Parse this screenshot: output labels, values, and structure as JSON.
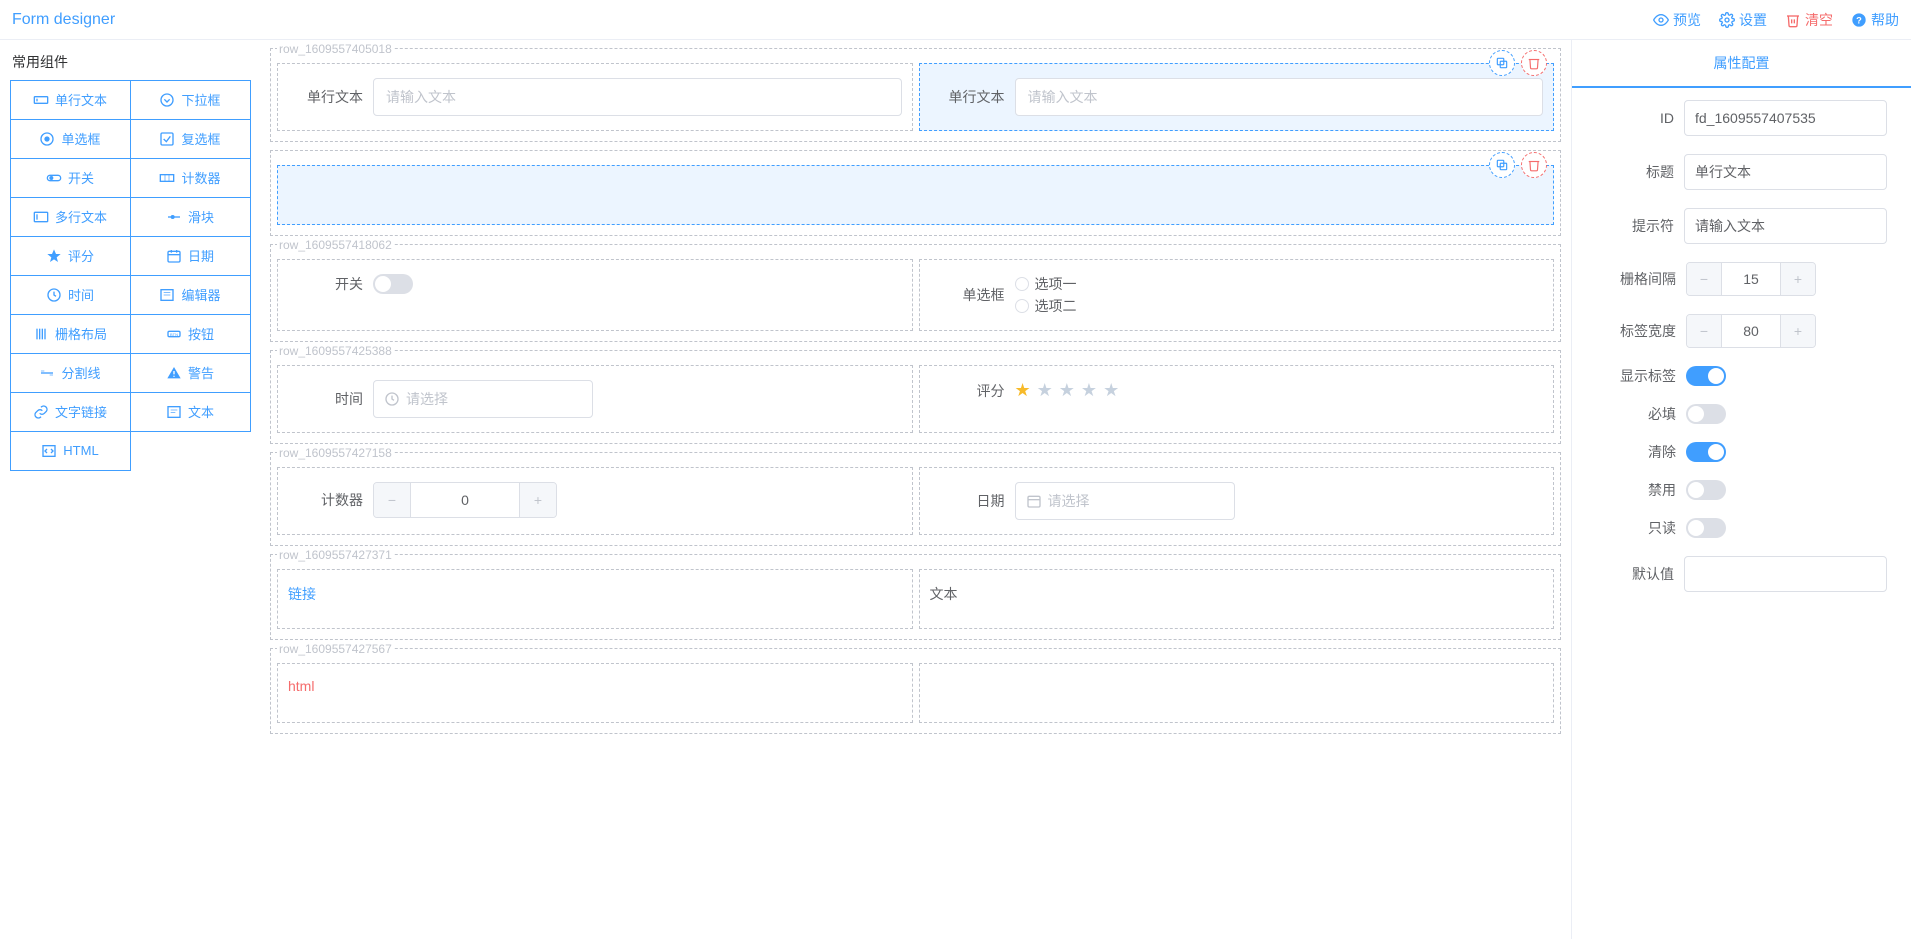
{
  "header": {
    "title": "Form designer",
    "buttons": {
      "preview": "预览",
      "settings": "设置",
      "clear": "清空",
      "help": "帮助"
    }
  },
  "sidebar": {
    "title": "常用组件",
    "items": [
      {
        "icon": "input",
        "label": "单行文本"
      },
      {
        "icon": "select",
        "label": "下拉框"
      },
      {
        "icon": "radio",
        "label": "单选框"
      },
      {
        "icon": "checkbox",
        "label": "复选框"
      },
      {
        "icon": "switch",
        "label": "开关"
      },
      {
        "icon": "counter",
        "label": "计数器"
      },
      {
        "icon": "textarea",
        "label": "多行文本"
      },
      {
        "icon": "slider",
        "label": "滑块"
      },
      {
        "icon": "rate",
        "label": "评分"
      },
      {
        "icon": "date",
        "label": "日期"
      },
      {
        "icon": "time",
        "label": "时间"
      },
      {
        "icon": "editor",
        "label": "编辑器"
      },
      {
        "icon": "grid",
        "label": "栅格布局"
      },
      {
        "icon": "button",
        "label": "按钮"
      },
      {
        "icon": "divider",
        "label": "分割线"
      },
      {
        "icon": "alert",
        "label": "警告"
      },
      {
        "icon": "link",
        "label": "文字链接"
      },
      {
        "icon": "text",
        "label": "文本"
      },
      {
        "icon": "html",
        "label": "HTML"
      }
    ]
  },
  "canvas": {
    "rows": [
      {
        "id": "row_1609557405018",
        "cells": [
          {
            "type": "input",
            "label": "单行文本",
            "placeholder": "请输入文本"
          },
          {
            "type": "input",
            "label": "单行文本",
            "placeholder": "请输入文本",
            "selected": true
          }
        ]
      },
      {
        "id": "",
        "cells": [
          {
            "type": "empty",
            "selected": true
          }
        ]
      },
      {
        "id": "row_1609557418062",
        "cells": [
          {
            "type": "switch",
            "label": "开关"
          },
          {
            "type": "radio",
            "label": "单选框",
            "options": [
              "选项一",
              "选项二"
            ]
          }
        ]
      },
      {
        "id": "row_1609557425388",
        "cells": [
          {
            "type": "time",
            "label": "时间",
            "placeholder": "请选择"
          },
          {
            "type": "rate",
            "label": "评分",
            "value": 1,
            "max": 5
          }
        ]
      },
      {
        "id": "row_1609557427158",
        "cells": [
          {
            "type": "counter",
            "label": "计数器",
            "value": "0"
          },
          {
            "type": "date",
            "label": "日期",
            "placeholder": "请选择"
          }
        ]
      },
      {
        "id": "row_1609557427371",
        "cells": [
          {
            "type": "link",
            "text": "链接"
          },
          {
            "type": "text",
            "text": "文本"
          }
        ]
      },
      {
        "id": "row_1609557427567",
        "cells": [
          {
            "type": "html",
            "text": "html"
          },
          {
            "type": "empty"
          }
        ]
      }
    ]
  },
  "props": {
    "tab": "属性配置",
    "id_label": "ID",
    "id_value": "fd_1609557407535",
    "title_label": "标题",
    "title_value": "单行文本",
    "placeholder_label": "提示符",
    "placeholder_value": "请输入文本",
    "gutter_label": "栅格间隔",
    "gutter_value": "15",
    "labelwidth_label": "标签宽度",
    "labelwidth_value": "80",
    "showlabel_label": "显示标签",
    "showlabel_on": true,
    "required_label": "必填",
    "required_on": false,
    "clearable_label": "清除",
    "clearable_on": true,
    "disabled_label": "禁用",
    "disabled_on": false,
    "readonly_label": "只读",
    "readonly_on": false,
    "default_label": "默认值",
    "default_value": ""
  }
}
